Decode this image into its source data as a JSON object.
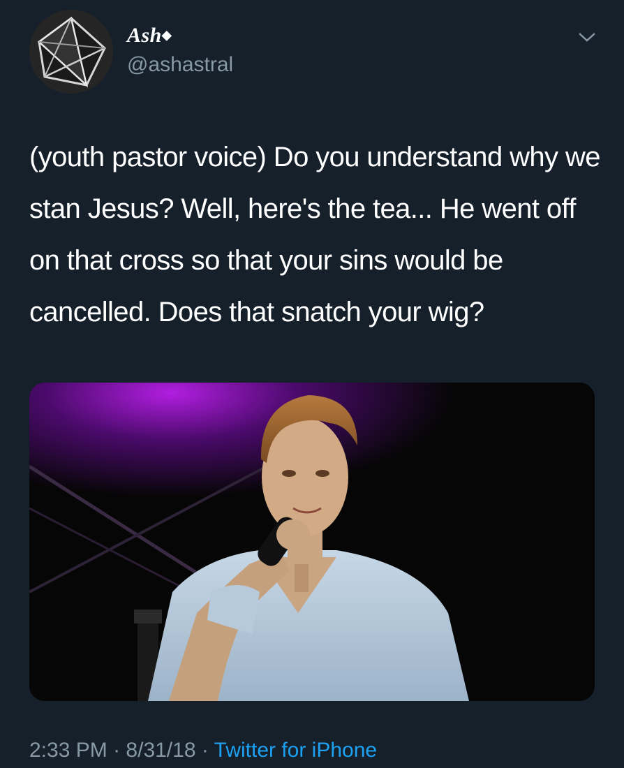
{
  "tweet": {
    "display_name": "Ash",
    "name_glyph": "◆",
    "handle": "@ashastral",
    "text": "(youth pastor voice) Do you understand why we stan Jesus? Well, here's the tea... He went off on that cross so that your sins would be cancelled. Does that snatch your wig?",
    "time": "2:33 PM",
    "separator": "·",
    "date": "8/31/18",
    "source": "Twitter for iPhone"
  },
  "icons": {
    "avatar": "geometric-triangle-avatar",
    "menu": "chevron-down-icon"
  },
  "colors": {
    "background": "#15202b",
    "text": "#ffffff",
    "secondary": "#8899a6",
    "link": "#1da1f2"
  }
}
